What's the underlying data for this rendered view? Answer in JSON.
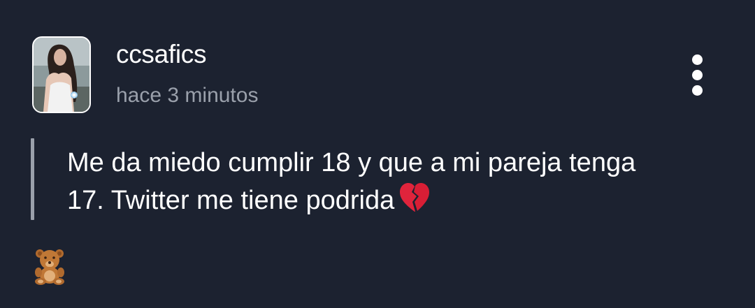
{
  "post": {
    "username": "ccsafics",
    "timestamp": "hace 3 minutos",
    "text": "Me da miedo cumplir 18 y que a mi pareja tenga 17. Twitter me tiene podrida",
    "text_emoji": "broken-heart-icon",
    "reaction_emoji": "teddy-bear-icon",
    "menu_icon": "more-vertical-icon"
  },
  "colors": {
    "background": "#1c2230",
    "primary_text": "#ffffff",
    "secondary_text": "#9aa0ab",
    "quote_bar": "#9aa0ab",
    "heart": "#e0243c"
  }
}
